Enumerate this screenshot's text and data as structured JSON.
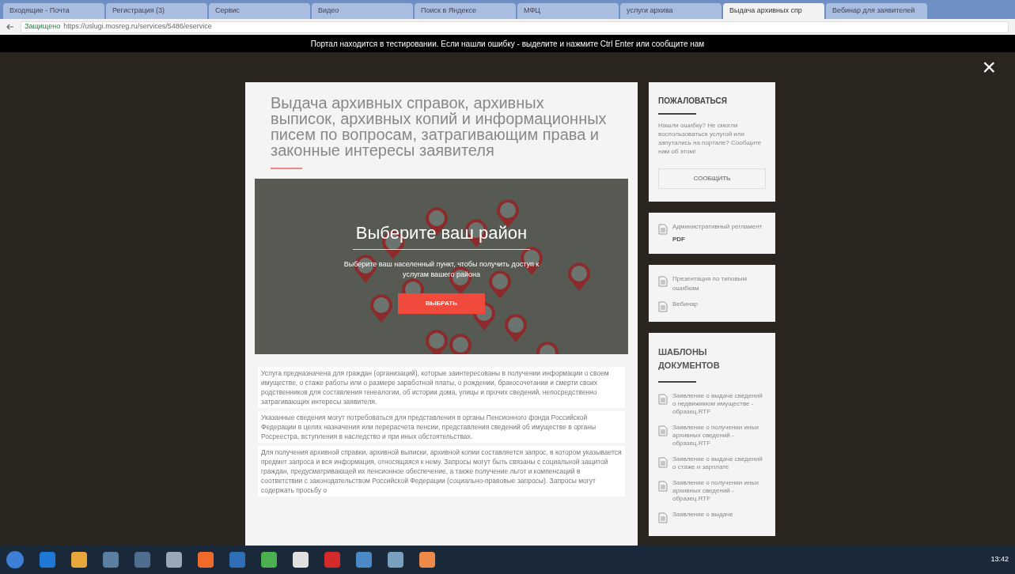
{
  "browser": {
    "tabs": [
      {
        "title": "Входящие - Почта",
        "selected": false
      },
      {
        "title": "Регистрация (3)",
        "selected": false
      },
      {
        "title": "Сервис",
        "selected": false
      },
      {
        "title": "Видео",
        "selected": false
      },
      {
        "title": "Поиск в Яндексе",
        "selected": false
      },
      {
        "title": "МФЦ",
        "selected": false
      },
      {
        "title": "услуги архива",
        "selected": false
      },
      {
        "title": "Выдача архивных спр",
        "selected": true
      },
      {
        "title": "Вебинар для заявителей",
        "selected": false
      }
    ],
    "security": "Защищено",
    "url": "https://uslugi.mosreg.ru/services/5486/eservice"
  },
  "banner": "Портал находится в тестировании. Если нашли ошибку - выделите и нажмите Ctrl Enter или сообщите нам",
  "modal": {
    "title": "Выдача архивных справок, архивных выписок, архивных копий и информационных писем по вопросам, затрагивающим права и законные интересы заявителя",
    "map": {
      "heading": "Выберите ваш район",
      "text": "Выберите ваш населенный пункт, чтобы получить доступ к услугам вашего района",
      "button": "ВЫБРАТЬ"
    },
    "paragraphs": [
      "Услуга предназначена для граждан (организаций), которые заинтересованы в получении информации о своем имуществе, о стаже работы или о размере заработной платы, о рождении, бракосочетании и смерти своих родственников для составления генеалогии, об истории дома, улицы и прочих сведений, непосредственно затрагивающих интересы заявителя.",
      "Указанные сведения могут потребоваться для представления в органы Пенсионного фонда Российской Федерации в целях назначения или перерасчета пенсии, представления сведений об имуществе в органы Росреестра, вступления в наследство и при иных обстоятельствах.",
      "Для получения архивной справки, архивной выписки, архивной копии составляется запрос, в котором указывается предмет запроса и вся информация, относящаяся к нему. Запросы могут быть связаны с социальной защитой граждан, предусматривающей их пенсионное обеспечение, а также получение льгот и компенсаций в соответствии с законодательством Российской Федерации (социально-правовые запросы). Запросы могут содержать просьбу о"
    ]
  },
  "sidebar": {
    "complaint": {
      "title": "ПОЖАЛОВАТЬСЯ",
      "text": "Нашли ошибку? Не смогли воспользоваться услугой или запутались на портале? Сообщите нам об этом!",
      "button": "СООБЩИТЬ"
    },
    "regulation": {
      "title": "Административный регламент",
      "format": "PDF"
    },
    "materials": [
      "Презентация по типовым ошибкам",
      "Вебинар"
    ],
    "templates": {
      "title": "ШАБЛОНЫ ДОКУМЕНТОВ",
      "items": [
        "Заявление о выдаче сведений о недвижимом имуществе - образец.RTF",
        "Заявление о получении иных архивных сведений - образец.RTF",
        "Заявление о выдаче сведений о стаже и зарплате",
        "Заявление о получении иных архивных сведений - образец.RTF",
        "Заявление о выдаче"
      ]
    }
  },
  "close": "×",
  "taskbar": {
    "clock": "13:42"
  }
}
